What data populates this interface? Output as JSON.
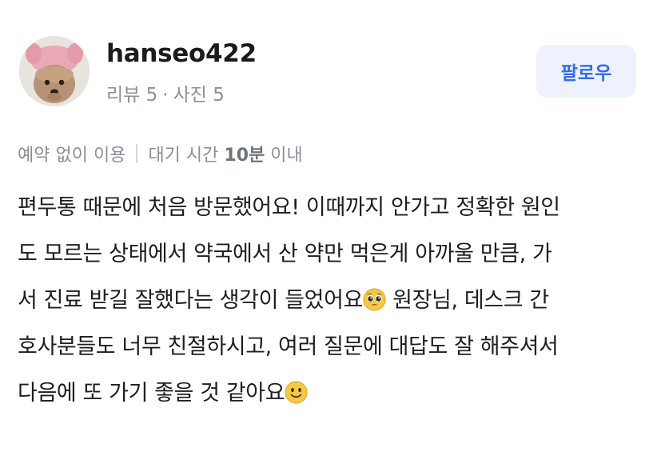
{
  "user": {
    "username": "hanseo422",
    "review_label": "리뷰",
    "review_count": "5",
    "separator": "·",
    "photo_label": "사진",
    "photo_count": "5"
  },
  "follow_button": {
    "label": "팔로우"
  },
  "visit_info": {
    "reservation": "예약 없이 이용",
    "wait_prefix": "대기 시간",
    "wait_value": "10분",
    "wait_suffix": "이내"
  },
  "review": {
    "lines": [
      "편두통 때문에 처음 방문했어요! 이때까지 안가고 정확한 원인",
      "도 모르는 상태에서 약국에서 산 약만 먹은게 아까울 만큼, 가",
      "서 진료 받길 잘했다는 생각이 들었어요",
      " 원장님, 데스크 간",
      "호사분들도 너무 친절하시고, 여러 질문에 대답도 잘 해주셔서",
      "다음에 또 가기 좋을 것 같아요"
    ],
    "emojis": [
      "pleading-face",
      "slightly-smiling-face"
    ]
  },
  "colors": {
    "accent": "#2d6cf1",
    "accent_bg": "#edf2fe",
    "text_primary": "#1d1d22",
    "text_secondary": "#8b8f96"
  }
}
